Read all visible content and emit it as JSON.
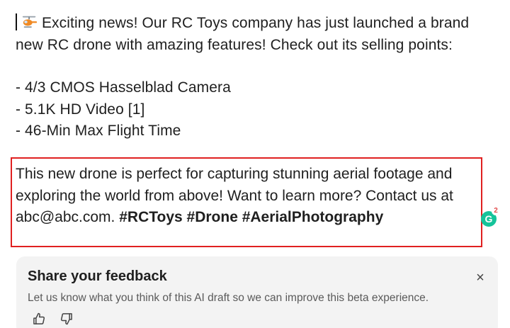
{
  "post": {
    "intro_text": "Exciting news! Our RC Toys company has just launched a brand new RC drone with amazing features! Check out its selling points:",
    "features": [
      "- 4/3 CMOS Hasselblad Camera",
      "- 5.1K HD Video [1]",
      "- 46-Min Max Flight Time"
    ],
    "closing_text": "This new drone is perfect for capturing stunning aerial footage and exploring the world from above! Want to learn more? Contact us at abc@abc.com. ",
    "hashtags": "#RCToys #Drone #AerialPhotography"
  },
  "grammarly": {
    "letter": "G",
    "count": "2",
    "color": "#15c39a"
  },
  "feedback": {
    "title": "Share your feedback",
    "text": "Let us know what you think of this AI draft so we can improve this beta experience.",
    "close_label": "×"
  },
  "colors": {
    "highlight_border": "#e02020",
    "feedback_bg": "#f3f3f3"
  },
  "icons": {
    "intro_emoji": "helicopter-icon",
    "like": "thumbs-up-icon",
    "dislike": "thumbs-down-icon",
    "close": "close-icon"
  }
}
